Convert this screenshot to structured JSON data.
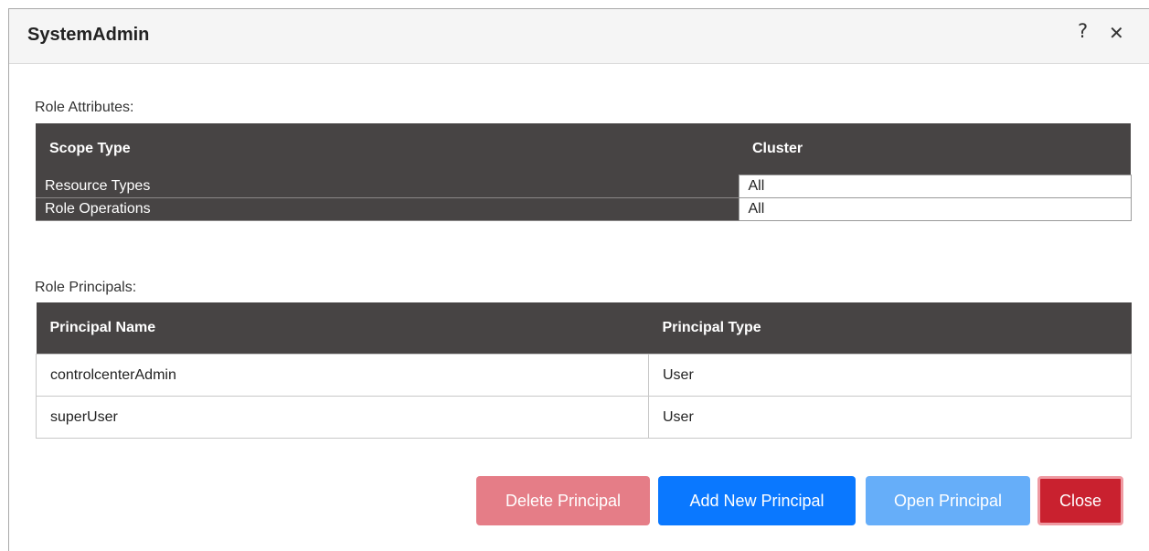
{
  "dialog": {
    "title": "SystemAdmin",
    "help_icon": "?",
    "close_icon": "✕"
  },
  "role_attributes": {
    "label": "Role Attributes:",
    "header": {
      "key": "Scope Type",
      "value": "Cluster"
    },
    "rows": [
      {
        "key": "Resource Types",
        "value": "All"
      },
      {
        "key": "Role Operations",
        "value": "All"
      }
    ]
  },
  "role_principals": {
    "label": "Role Principals:",
    "columns": [
      "Principal Name",
      "Principal Type"
    ],
    "rows": [
      {
        "name": "controlcenterAdmin",
        "type": "User"
      },
      {
        "name": "superUser",
        "type": "User"
      }
    ]
  },
  "buttons": {
    "delete": "Delete Principal",
    "add": "Add New Principal",
    "open": "Open Principal",
    "close": "Close"
  },
  "colors": {
    "table_header": "#474444",
    "delete_button": "#e57d87",
    "add_button": "#0a78ff",
    "open_button": "#66aef9",
    "close_button": "#c9212f"
  }
}
